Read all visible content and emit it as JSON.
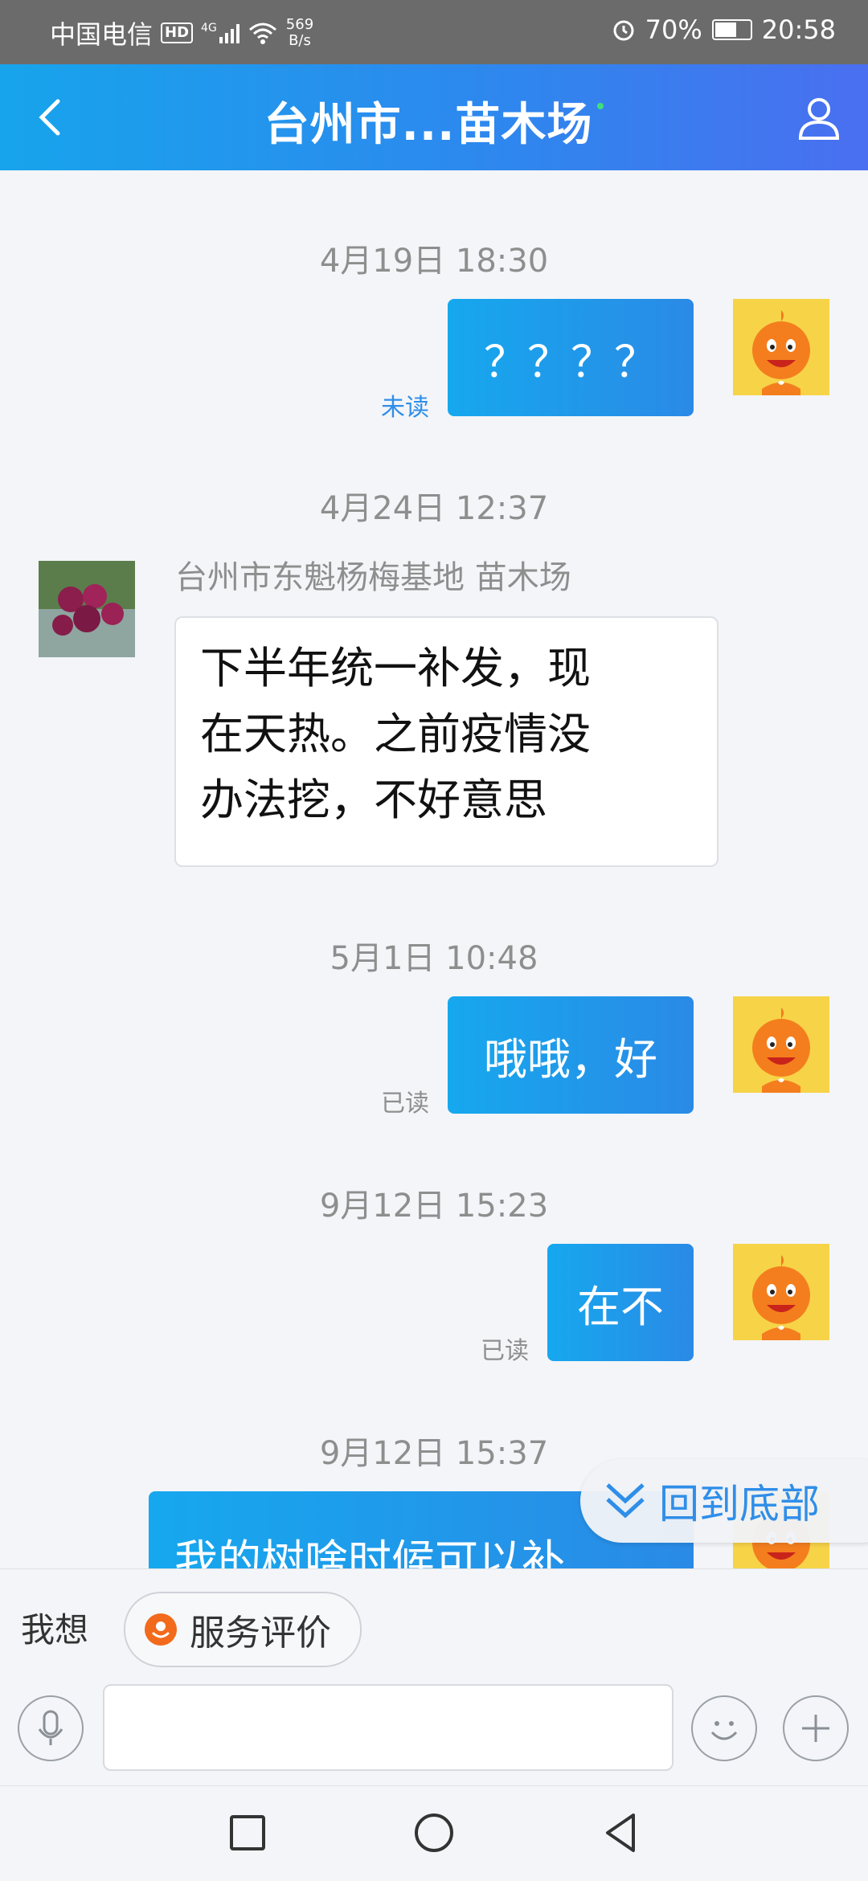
{
  "status_bar": {
    "carrier": "中国电信",
    "hd": "HD",
    "network": "4G",
    "speed_value": "569",
    "speed_unit": "B/s",
    "battery": "70%",
    "battery_level": 0.7,
    "time": "20:58"
  },
  "header": {
    "title": "台州市...苗木场",
    "back_icon": "chevron-left-icon",
    "profile_icon": "person-icon"
  },
  "messages": [
    {
      "time": "4月19日 18:30",
      "text": "？？？？",
      "status": "未读"
    },
    {
      "time": "4月24日 12:37",
      "sender": "台州市东魁杨梅基地 苗木场",
      "text_lines": [
        "下半年统一补发，现",
        "在天热。之前疫情没",
        "办法挖，不好意思"
      ]
    },
    {
      "time": "5月1日 10:48",
      "text": "哦哦，好",
      "status": "已读"
    },
    {
      "time": "9月12日 15:23",
      "text": "在不",
      "status": "已读"
    },
    {
      "time": "9月12日 15:37",
      "text": "我的树啥时候可以补"
    }
  ],
  "back_to_bottom": "回到底部",
  "quick_bar": {
    "label": "我想",
    "chip": "服务评价"
  },
  "input_bar": {
    "mic_icon": "microphone-icon",
    "emoji_icon": "smiley-icon",
    "plus_icon": "plus-icon"
  },
  "nav_bar": {
    "recent_icon": "square-icon",
    "home_icon": "circle-icon",
    "back_icon": "triangle-back-icon"
  },
  "colors": {
    "header_start": "#17a4ec",
    "header_end": "#4a6ff0",
    "bubble_out": "#1ea0ec",
    "unread": "#2f8ee8",
    "chip_icon": "#f26a1b"
  }
}
